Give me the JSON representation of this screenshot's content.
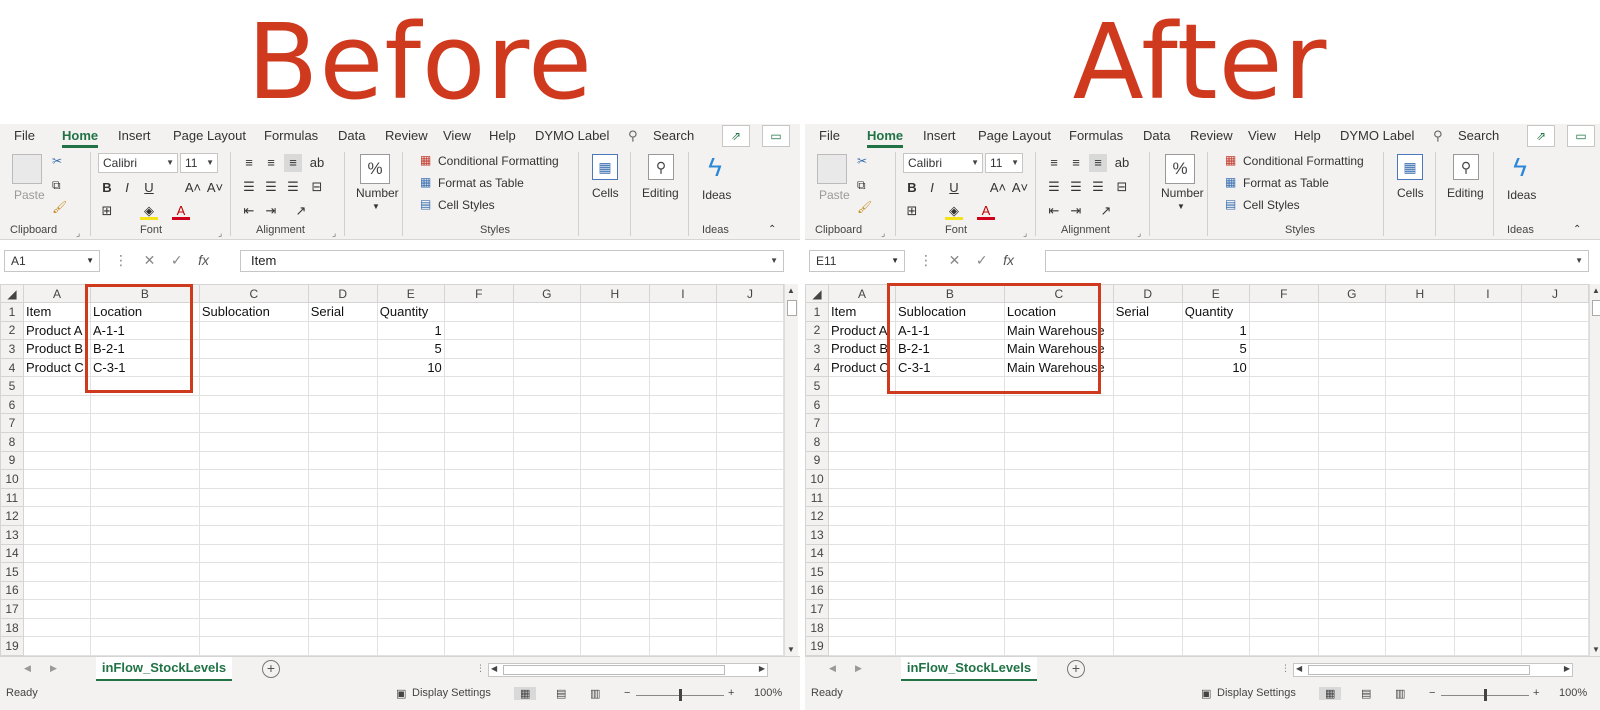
{
  "headlines": {
    "before": "Before",
    "after": "After"
  },
  "menu": {
    "tabs": [
      "File",
      "Home",
      "Insert",
      "Page Layout",
      "Formulas",
      "Data",
      "Review",
      "View",
      "Help",
      "DYMO Label"
    ],
    "search": "Search"
  },
  "ribbon": {
    "clipboard": {
      "paste": "Paste",
      "label": "Clipboard"
    },
    "font": {
      "name": "Calibri",
      "size": "11",
      "label": "Font"
    },
    "alignment": {
      "label": "Alignment"
    },
    "number": {
      "label": "Number"
    },
    "styles": {
      "conditional": "Conditional Formatting",
      "format_table": "Format as Table",
      "cell_styles": "Cell Styles",
      "label": "Styles"
    },
    "cells": {
      "label": "Cells"
    },
    "editing": {
      "label": "Editing"
    },
    "ideas": {
      "label": "Ideas",
      "group": "Ideas"
    }
  },
  "columns": [
    "A",
    "B",
    "C",
    "D",
    "E",
    "F",
    "G",
    "H",
    "I",
    "J"
  ],
  "rows": [
    "1",
    "2",
    "3",
    "4",
    "5",
    "6",
    "7",
    "8",
    "9",
    "10",
    "11",
    "12",
    "13",
    "14",
    "15",
    "16",
    "17",
    "18",
    "19"
  ],
  "before": {
    "namebox": "A1",
    "formula": "Item",
    "cells": [
      [
        "Item",
        "Location",
        "Sublocation",
        "Serial",
        "Quantity"
      ],
      [
        "Product A",
        "A-1-1",
        "",
        "",
        "1"
      ],
      [
        "Product B",
        "B-2-1",
        "",
        "",
        "5"
      ],
      [
        "Product C",
        "C-3-1",
        "",
        "",
        "10"
      ]
    ]
  },
  "after": {
    "namebox": "E11",
    "formula": "",
    "cells": [
      [
        "Item",
        "Sublocation",
        "Location",
        "Serial",
        "Quantity"
      ],
      [
        "Product A",
        "A-1-1",
        "Main Warehouse",
        "",
        "1"
      ],
      [
        "Product B",
        "B-2-1",
        "Main Warehouse",
        "",
        "5"
      ],
      [
        "Product C",
        "C-3-1",
        "Main Warehouse",
        "",
        "10"
      ]
    ]
  },
  "sheet_tab": "inFlow_StockLevels",
  "status": {
    "ready": "Ready",
    "display_settings": "Display Settings",
    "zoom": "100%"
  },
  "colors": {
    "accent": "#217346",
    "highlight": "#cf3a1f"
  }
}
